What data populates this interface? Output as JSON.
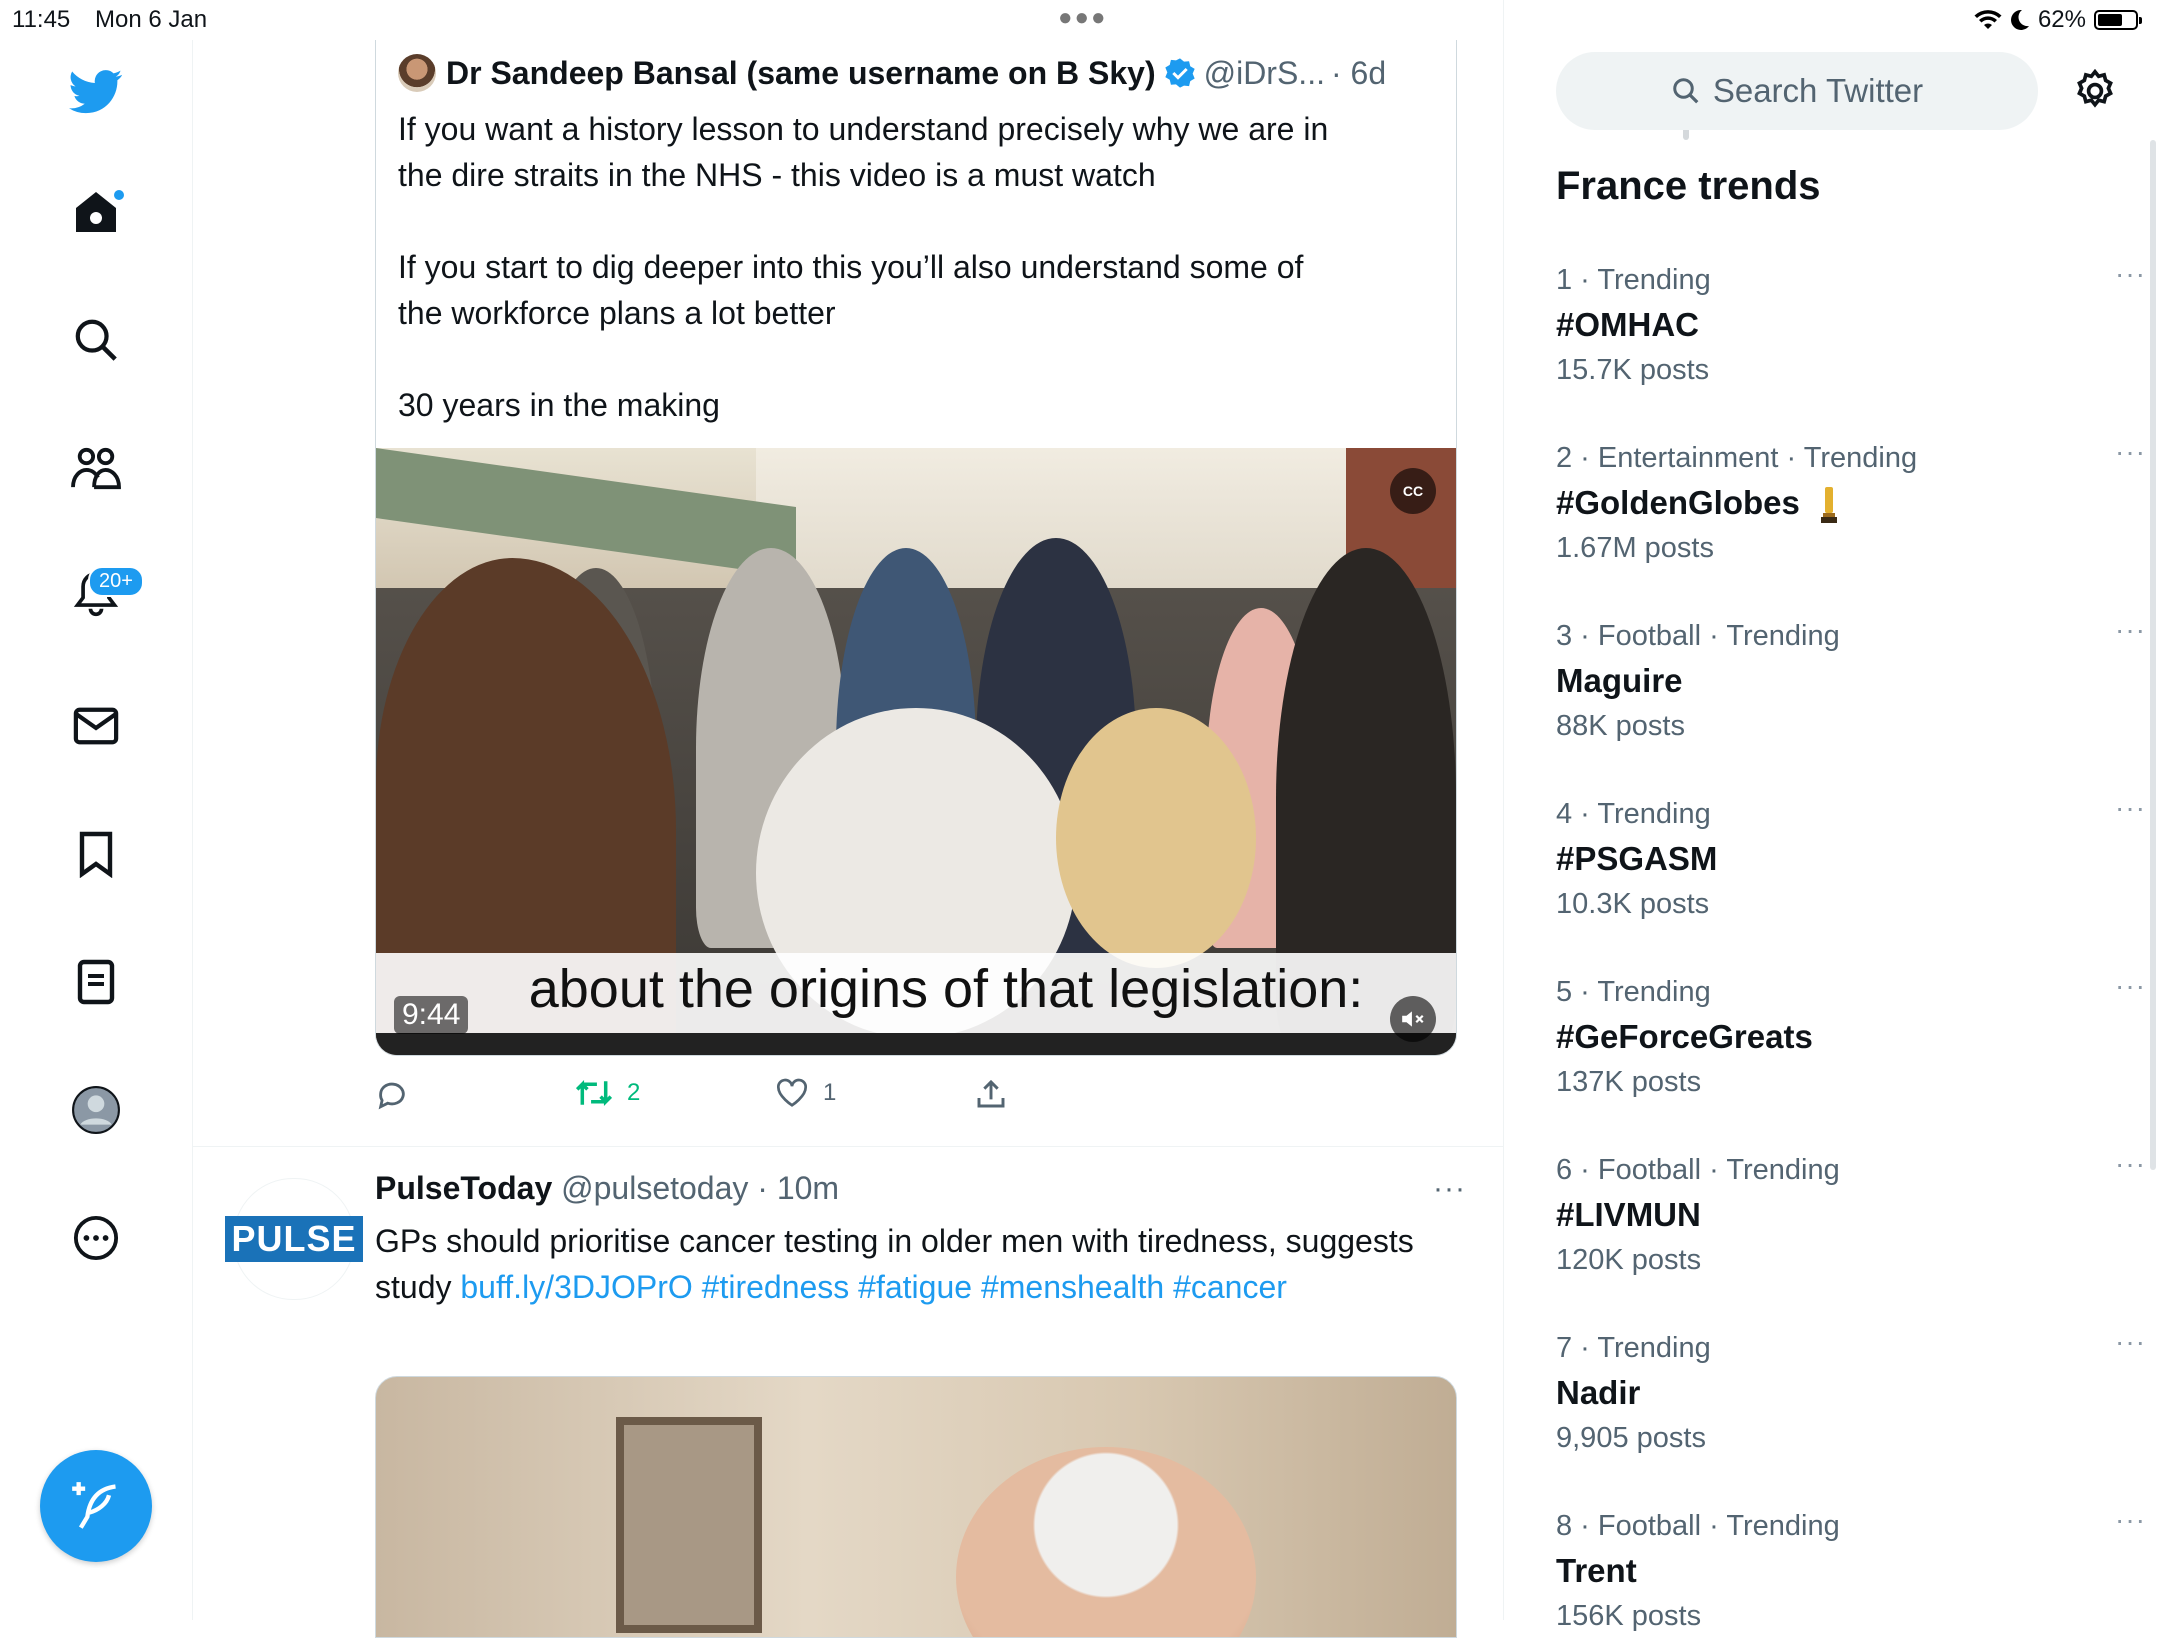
{
  "statusbar": {
    "time": "11:45",
    "date": "Mon 6 Jan",
    "battery": "62%"
  },
  "nav": {
    "notifications_badge": "20+"
  },
  "quoted_tweet": {
    "name": "Dr Sandeep Bansal (same username on B Sky)",
    "handle": "@iDrS...",
    "age": "· 6d",
    "text": "If you want a history lesson to understand precisely why we are in\nthe dire straits in the NHS - this video is a must watch\n\nIf you start to dig deeper into this you’ll also understand some of\nthe workforce plans a lot better\n\n30 years in the making",
    "video": {
      "subtitle": "about the origins of that legislation:",
      "duration": "9:44"
    }
  },
  "actions": {
    "retweets": "2",
    "likes": "1"
  },
  "tweet2": {
    "avatar_label": "PULSE",
    "name": "PulseToday",
    "handle": "@pulsetoday",
    "age": "· 10m",
    "text": "GPs should prioritise cancer testing in older men with tiredness, suggests study",
    "link": "buff.ly/3DJOPrO",
    "tags": [
      "#tiredness",
      "#fatigue",
      "#menshealth",
      "#cancer"
    ]
  },
  "search": {
    "placeholder": "Search Twitter"
  },
  "trends": {
    "title": "France trends",
    "items": [
      {
        "meta": "1 · Trending",
        "name": "#OMHAC",
        "count": "15.7K posts"
      },
      {
        "meta": "2 · Entertainment · Trending",
        "name": "#GoldenGlobes",
        "count": "1.67M posts"
      },
      {
        "meta": "3 · Football · Trending",
        "name": "Maguire",
        "count": "88K posts"
      },
      {
        "meta": "4 · Trending",
        "name": "#PSGASM",
        "count": "10.3K posts"
      },
      {
        "meta": "5 · Trending",
        "name": "#GeForceGreats",
        "count": "137K posts"
      },
      {
        "meta": "6 · Football · Trending",
        "name": "#LIVMUN",
        "count": "120K posts"
      },
      {
        "meta": "7 · Trending",
        "name": "Nadir",
        "count": "9,905 posts"
      },
      {
        "meta": "8 · Football · Trending",
        "name": "Trent",
        "count": "156K posts"
      }
    ]
  },
  "colors": {
    "accent": "#1d9bf0",
    "retweet": "#00ba7c",
    "muted": "#536471"
  },
  "icons": [
    "twitter-logo-icon",
    "home-icon",
    "search-icon",
    "communities-icon",
    "bell-icon",
    "mail-icon",
    "bookmark-icon",
    "lists-icon",
    "profile-icon",
    "more-circle-icon",
    "compose-icon",
    "reply-icon",
    "retweet-icon",
    "like-icon",
    "share-icon",
    "gear-icon",
    "verified-icon",
    "trophy-icon"
  ]
}
